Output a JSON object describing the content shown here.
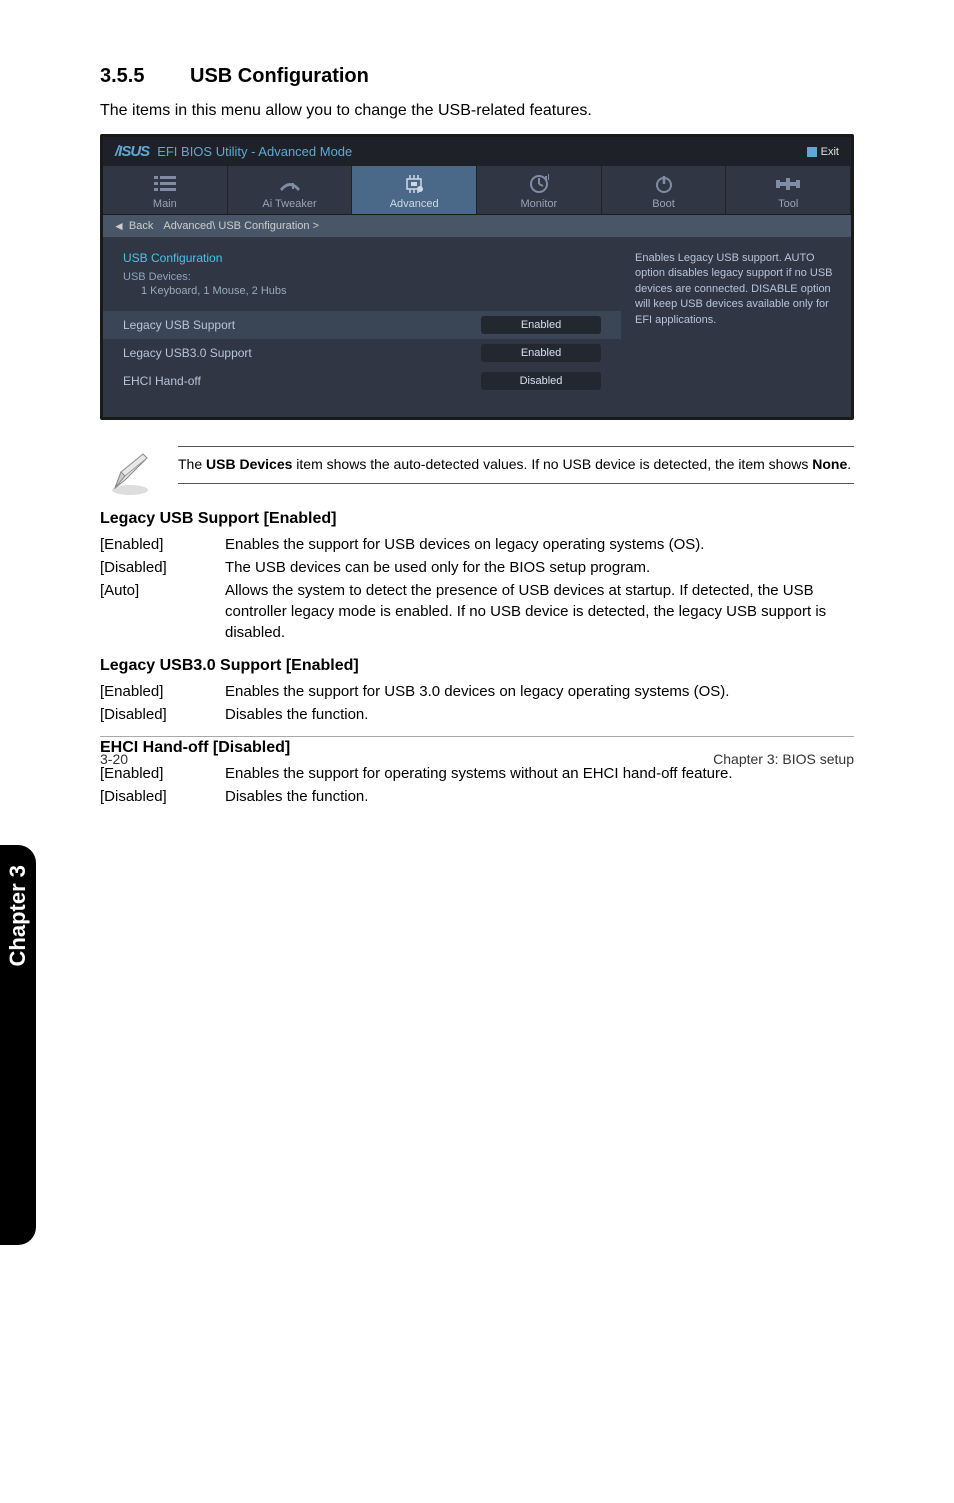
{
  "section": {
    "number": "3.5.5",
    "title": "USB Configuration"
  },
  "section_desc": "The items in this menu allow you to change the USB-related features.",
  "bios": {
    "title": "EFI BIOS Utility - Advanced Mode",
    "exit": "Exit",
    "tabs": [
      {
        "label": "Main"
      },
      {
        "label": "Ai Tweaker"
      },
      {
        "label": "Advanced"
      },
      {
        "label": "Monitor"
      },
      {
        "label": "Boot"
      },
      {
        "label": "Tool"
      }
    ],
    "back": "Back",
    "breadcrumb": "Advanced\\ USB Configuration >",
    "heading": "USB Configuration",
    "subheading": "USB Devices:",
    "subvalue": "1 Keyboard, 1 Mouse, 2 Hubs",
    "rows": [
      {
        "label": "Legacy USB Support",
        "value": "Enabled"
      },
      {
        "label": "Legacy USB3.0 Support",
        "value": "Enabled"
      },
      {
        "label": "EHCI Hand-off",
        "value": "Disabled"
      }
    ],
    "help": "Enables Legacy USB support. AUTO option disables legacy support if no USB devices are connected. DISABLE option will keep USB devices available only for EFI applications."
  },
  "note": {
    "pre": "The ",
    "bold1": "USB Devices",
    "mid": " item shows the auto-detected values. If no USB device is detected, the item shows ",
    "bold2": "None",
    "post": "."
  },
  "sub1": {
    "title": "Legacy USB Support [Enabled]",
    "opts": [
      {
        "label": "[Enabled]",
        "desc": "Enables the support for USB devices on legacy operating systems (OS)."
      },
      {
        "label": "[Disabled]",
        "desc": "The USB devices can be used only for the BIOS setup program."
      },
      {
        "label": "[Auto]",
        "desc": "Allows the system to detect the presence of USB devices at startup. If detected, the USB controller legacy mode is enabled. If no USB device is detected, the legacy USB support is disabled."
      }
    ]
  },
  "sub2": {
    "title": "Legacy USB3.0 Support [Enabled]",
    "opts": [
      {
        "label": "[Enabled]",
        "desc": "Enables the support for USB 3.0 devices on legacy operating systems (OS)."
      },
      {
        "label": "[Disabled]",
        "desc": "Disables the function."
      }
    ]
  },
  "sub3": {
    "title": "EHCI Hand-off [Disabled]",
    "opts": [
      {
        "label": "[Enabled]",
        "desc": "Enables the support for operating systems without an EHCI hand-off feature."
      },
      {
        "label": "[Disabled]",
        "desc": "Disables the function."
      }
    ]
  },
  "side_tab": "Chapter 3",
  "footer": {
    "left": "3-20",
    "right": "Chapter 3: BIOS setup"
  }
}
